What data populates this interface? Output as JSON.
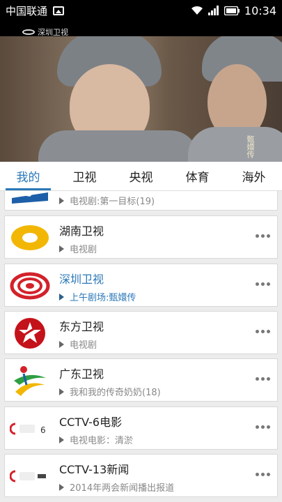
{
  "status_bar": {
    "carrier": "中国联通",
    "time": "10:34",
    "icons": [
      "image-notification-icon",
      "wifi-icon",
      "signal-icon",
      "battery-icon"
    ]
  },
  "video": {
    "channel_logo_text": "深圳卫视",
    "drama_mark_text": "甄嬛传"
  },
  "tabs": [
    {
      "label": "我的",
      "active": true
    },
    {
      "label": "卫视",
      "active": false
    },
    {
      "label": "央视",
      "active": false
    },
    {
      "label": "体育",
      "active": false
    },
    {
      "label": "海外",
      "active": false
    }
  ],
  "channels": [
    {
      "name": "",
      "program": "电视剧:第一目标(19)",
      "logo": "partial-blue-logo",
      "highlight": false
    },
    {
      "name": "湖南卫视",
      "program": "电视剧",
      "logo": "hunan-tv-logo",
      "highlight": false
    },
    {
      "name": "深圳卫视",
      "program": "上午剧场:甄嬛传",
      "logo": "shenzhen-tv-logo",
      "highlight": true
    },
    {
      "name": "东方卫视",
      "program": "电视剧",
      "logo": "dragon-tv-logo",
      "highlight": false
    },
    {
      "name": "广东卫视",
      "program": "我和我的传奇奶奶(18)",
      "logo": "guangdong-tv-logo",
      "highlight": false
    },
    {
      "name": "CCTV-6电影",
      "program": "电视电影：清淤",
      "logo": "cctv6-logo",
      "highlight": false
    },
    {
      "name": "CCTV-13新闻",
      "program": "2014年两会新闻播出报道",
      "logo": "cctv13-logo",
      "highlight": false
    }
  ],
  "colors": {
    "accent": "#2b78b8",
    "hunan_yellow": "#f2b705",
    "shenzhen_red": "#d3222a",
    "dongfang_red": "#c4121a",
    "guangdong_green": "#2e9e44"
  }
}
